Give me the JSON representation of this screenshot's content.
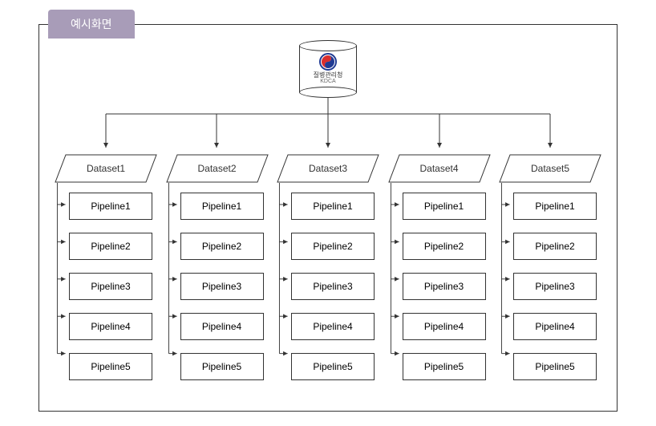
{
  "tab_label": "예시화면",
  "source": {
    "org_kr": "질병관리청",
    "org_en": "KDCA"
  },
  "columns": [
    {
      "dataset": "Dataset1",
      "pipelines": [
        "Pipeline1",
        "Pipeline2",
        "Pipeline3",
        "Pipeline4",
        "Pipeline5"
      ]
    },
    {
      "dataset": "Dataset2",
      "pipelines": [
        "Pipeline1",
        "Pipeline2",
        "Pipeline3",
        "Pipeline4",
        "Pipeline5"
      ]
    },
    {
      "dataset": "Dataset3",
      "pipelines": [
        "Pipeline1",
        "Pipeline2",
        "Pipeline3",
        "Pipeline4",
        "Pipeline5"
      ]
    },
    {
      "dataset": "Dataset4",
      "pipelines": [
        "Pipeline1",
        "Pipeline2",
        "Pipeline3",
        "Pipeline4",
        "Pipeline5"
      ]
    },
    {
      "dataset": "Dataset5",
      "pipelines": [
        "Pipeline1",
        "Pipeline2",
        "Pipeline3",
        "Pipeline4",
        "Pipeline5"
      ]
    }
  ],
  "colors": {
    "tab_bg": "#a89cb8",
    "logo_red": "#d92e2e",
    "logo_blue": "#1f3a93",
    "border": "#333333"
  }
}
